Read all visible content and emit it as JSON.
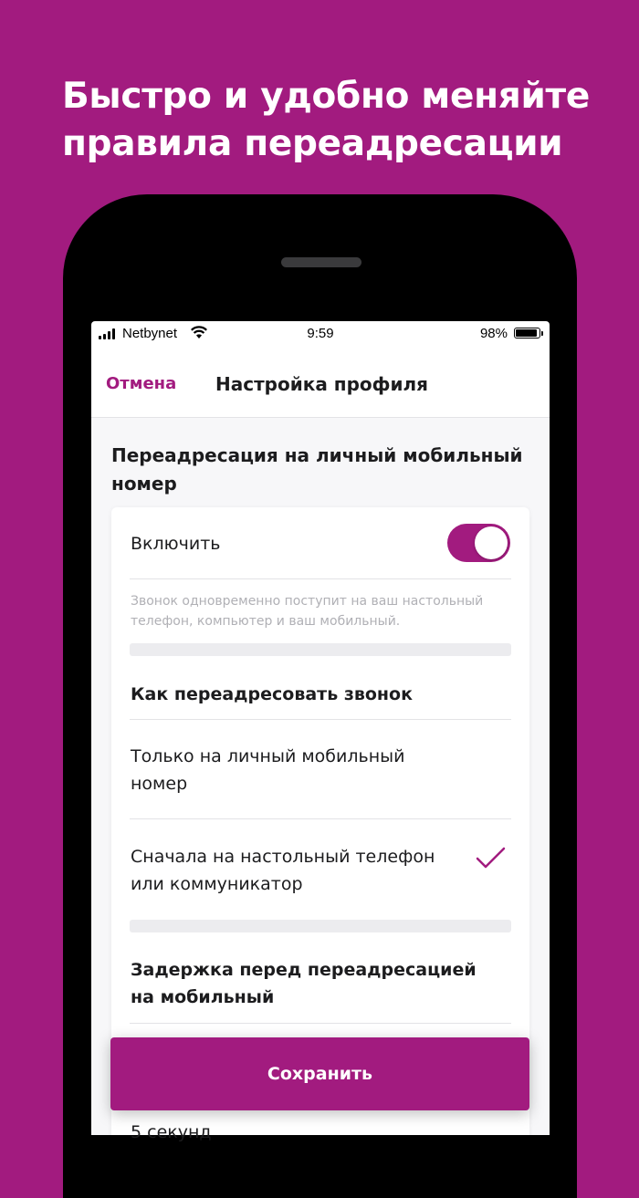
{
  "headline": {
    "line1": "Быстро и удобно меняйте",
    "line2": "правила переадресации"
  },
  "status_bar": {
    "carrier": "Netbynet",
    "time": "9:59",
    "battery": "98%"
  },
  "nav": {
    "cancel": "Отмена",
    "title": "Настройка профиля"
  },
  "section": {
    "title_line1": "Переадресация на личный мобильный",
    "title_line2": "номер"
  },
  "card": {
    "enable_label": "Включить",
    "enable_on": true,
    "hint": "Звонок одновременно поступит на ваш настольный телефон, компьютер и ваш мобильный.",
    "how_title": "Как переадресовать звонок",
    "option1_line1": "Только на личный мобильный",
    "option1_line2": "номер",
    "option2_line1": "Сначала на настольный телефон",
    "option2_line2": "или коммуникатор",
    "option2_selected": true,
    "delay_title_line1": "Задержка перед переадресацией",
    "delay_title_line2": "на мобильный",
    "delay_value": "5 секунд"
  },
  "save_button": "Сохранить",
  "colors": {
    "brand": "#a21b7f",
    "background": "#a21b7f"
  }
}
